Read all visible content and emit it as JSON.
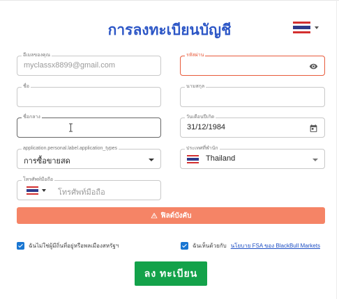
{
  "title": "การลงทะเบียนบัญชี",
  "colors": {
    "brand_blue": "#2c56c6",
    "error": "#e85a3a",
    "warning_bar": "#f58466",
    "submit": "#13a24a",
    "checkbox": "#1976d2"
  },
  "language_selector": {
    "flag": "thai-flag-icon"
  },
  "fields": {
    "email": {
      "label": "อีเมลของคุณ",
      "value": "myclassx8899@gmail.com"
    },
    "password": {
      "label": "รหัสผ่าน",
      "value": ""
    },
    "first_name": {
      "label": "ชื่อ",
      "value": ""
    },
    "last_name": {
      "label": "นามสกุล",
      "value": ""
    },
    "middle_name": {
      "label": "ชื่อกลาง",
      "value": ""
    },
    "birth_date": {
      "label": "วันเดือนปีเกิด",
      "value": "31/12/1984"
    },
    "application_type": {
      "label": "application.personal.label.application_types",
      "value": "การซื้อขายสด"
    },
    "country": {
      "label": "ประเทศที่พำนัก",
      "value": "Thailand"
    },
    "phone": {
      "label": "โทรศัพท์มือถือ",
      "placeholder": "โทรศัพท์มือถือ"
    }
  },
  "warning": {
    "icon": "warning-icon",
    "text": "ฟิลด์บังคับ"
  },
  "checks": {
    "not_us": {
      "checked": true,
      "text": "ฉันไม่ใช่ผู้มีถิ่นที่อยู่หรือพลเมืองสหรัฐฯ"
    },
    "fsa": {
      "checked": true,
      "prefix": "ฉันเห็นด้วยกับ",
      "link": "นโยบาย FSA ของ BlackBull Markets"
    }
  },
  "submit_label": "ลง ทะเบียน"
}
